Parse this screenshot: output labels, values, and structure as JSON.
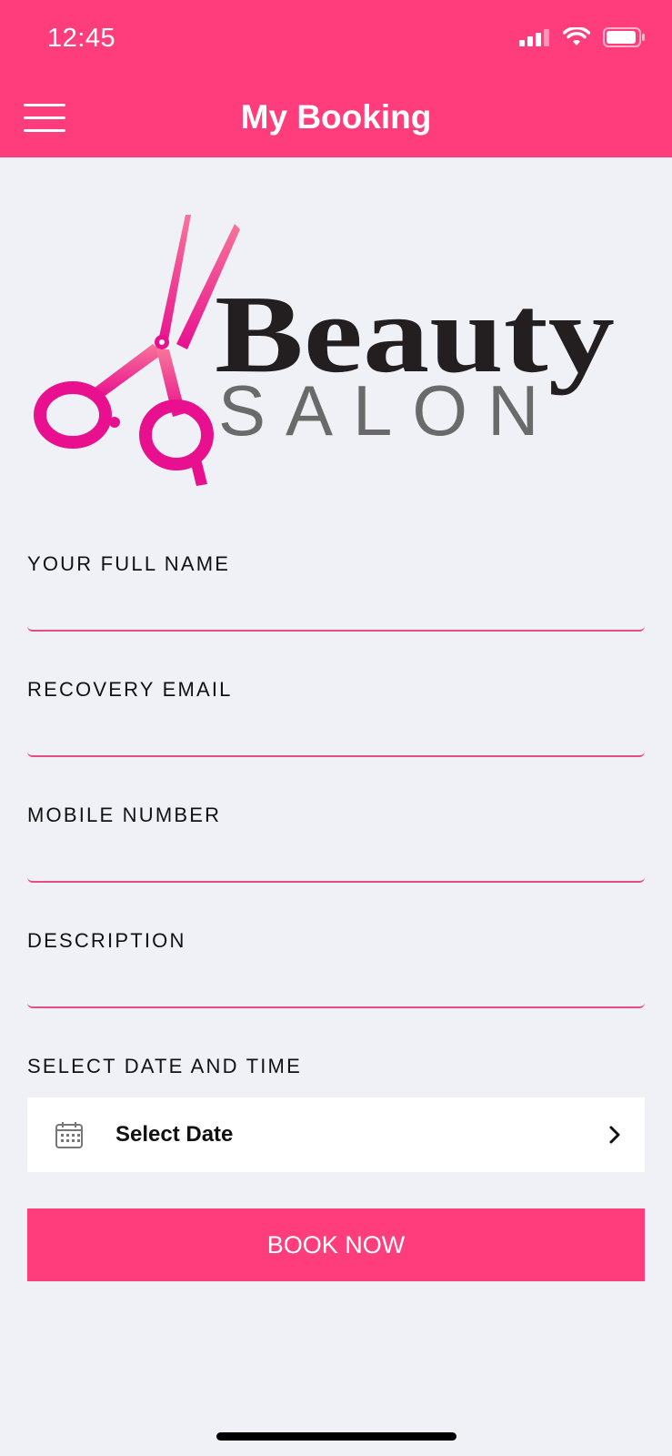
{
  "status_bar": {
    "time": "12:45"
  },
  "header": {
    "title": "My Booking"
  },
  "logo": {
    "word1": "Beauty",
    "word2": "SALON"
  },
  "form": {
    "full_name": {
      "label": "YOUR FULL NAME",
      "value": ""
    },
    "email": {
      "label": "RECOVERY EMAIL",
      "value": ""
    },
    "mobile": {
      "label": "MOBILE NUMBER",
      "value": ""
    },
    "description": {
      "label": "DESCRIPTION",
      "value": ""
    },
    "date_time": {
      "label": "SELECT DATE AND TIME",
      "select_label": "Select Date"
    }
  },
  "actions": {
    "book_label": "BOOK NOW"
  },
  "colors": {
    "brand": "#ff3d7c",
    "underline": "#e64b83",
    "background": "#eff1f6"
  },
  "icons": [
    "menu-icon",
    "signal-icon",
    "wifi-icon",
    "battery-icon",
    "calendar-icon",
    "chevron-right-icon"
  ]
}
